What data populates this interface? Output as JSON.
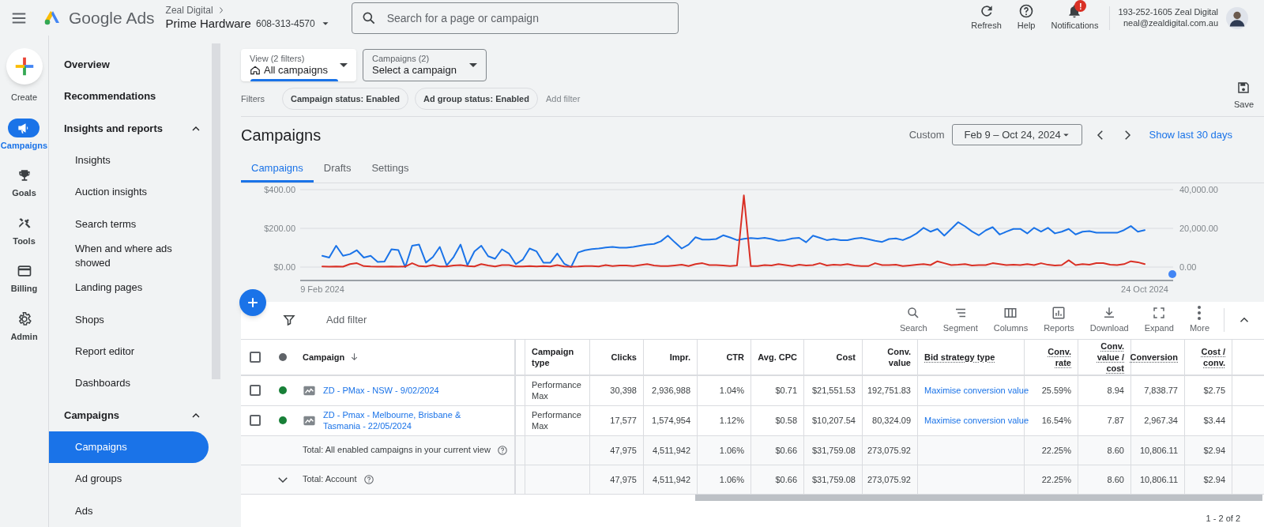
{
  "header": {
    "product": "Google Ads",
    "account": {
      "manager": "Zeal Digital",
      "name": "Prime Hardware",
      "id": "608-313-4570"
    },
    "search": {
      "placeholder": "Search for a page or campaign"
    },
    "actions": [
      {
        "label": "Refresh",
        "kind": "refresh"
      },
      {
        "label": "Help",
        "kind": "help"
      },
      {
        "label": "Notifications",
        "kind": "bell",
        "badge": "!"
      }
    ],
    "user": {
      "line_1": "193-252-1605 Zeal Digital",
      "line_2": "neal@zealdigital.com.au"
    }
  },
  "rail": [
    {
      "label": "Create",
      "kind": "create",
      "selected": false
    },
    {
      "label": "Campaigns",
      "kind": "megaphone",
      "selected": true
    },
    {
      "label": "Goals",
      "kind": "trophy",
      "selected": false
    },
    {
      "label": "Tools",
      "kind": "tools",
      "selected": false
    },
    {
      "label": "Billing",
      "kind": "card",
      "selected": false
    },
    {
      "label": "Admin",
      "kind": "gear",
      "selected": false
    }
  ],
  "nav": [
    {
      "label": "Overview",
      "selected": false
    },
    {
      "label": "Recommendations",
      "selected": false
    },
    {
      "label": "Insights and reports",
      "selected": false,
      "expanded": true,
      "children": [
        {
          "label": "Insights",
          "selected": false
        },
        {
          "label": "Auction insights",
          "selected": false
        },
        {
          "label": "Search terms",
          "selected": false
        },
        {
          "label": "When and where ads showed",
          "selected": false
        },
        {
          "label": "Landing pages",
          "selected": false
        },
        {
          "label": "Shops",
          "selected": false
        },
        {
          "label": "Report editor",
          "selected": false
        },
        {
          "label": "Dashboards",
          "selected": false
        }
      ]
    },
    {
      "label": "Campaigns",
      "selected": false,
      "expanded": true,
      "children": [
        {
          "label": "Campaigns",
          "selected": true
        },
        {
          "label": "Ad groups",
          "selected": false
        },
        {
          "label": "Ads",
          "selected": false
        }
      ]
    }
  ],
  "pickers": [
    {
      "label": "View (2 filters)",
      "value": "All campaigns",
      "kind": "view"
    },
    {
      "label": "Campaigns (2)",
      "value": "Select a campaign",
      "kind": "plain"
    }
  ],
  "filters": {
    "label": "Filters",
    "chips": [
      "Campaign status: Enabled",
      "Ad group status: Enabled"
    ],
    "add": "Add filter"
  },
  "save": "Save",
  "title": "Campaigns",
  "date": {
    "label": "Custom",
    "range": "Feb 9 – Oct 24, 2024",
    "link": "Show last 30 days"
  },
  "tabs": [
    {
      "label": "Campaigns",
      "selected": true
    },
    {
      "label": "Drafts",
      "selected": false
    },
    {
      "label": "Settings",
      "selected": false
    }
  ],
  "chart": {
    "right_ticks": [
      "40,000.00",
      "20,000.00",
      "0.00"
    ],
    "chart_data": {
      "type": "line",
      "ylim": [
        0,
        400
      ],
      "yticks": [
        {
          "value": 0,
          "label": "$0.00"
        },
        {
          "value": 200,
          "label": "$200.00"
        },
        {
          "value": 400,
          "label": "$400.00"
        }
      ],
      "categories": [
        "9 Feb 2024",
        null,
        null,
        null,
        null,
        null,
        null,
        null,
        null,
        null,
        null,
        null,
        null,
        null,
        null,
        null,
        null,
        null,
        null,
        null,
        null,
        null,
        null,
        null,
        null,
        null,
        null,
        null,
        null,
        null,
        null,
        null,
        null,
        null,
        null,
        null,
        null,
        null,
        null,
        null,
        null,
        null,
        null,
        null,
        null,
        null,
        null,
        null,
        null,
        null,
        null,
        null,
        null,
        null,
        null,
        null,
        null,
        null,
        null,
        null,
        null,
        null,
        null,
        null,
        null,
        null,
        null,
        null,
        null,
        null,
        null,
        null,
        null,
        null,
        null,
        null,
        null,
        null,
        null,
        null,
        null,
        null,
        null,
        null,
        null,
        null,
        null,
        null,
        null,
        null,
        null,
        null,
        null,
        null,
        null,
        null,
        null,
        null,
        null,
        null,
        null,
        null,
        null,
        null,
        null,
        null,
        null,
        null,
        null,
        null,
        null,
        null,
        null,
        null,
        null,
        null,
        null,
        null,
        null,
        "24 Oct 2024"
      ],
      "series": [
        {
          "color": "#1a73e8",
          "values": [
            58,
            49,
            110,
            58,
            67,
            87,
            49,
            58,
            27,
            28,
            92,
            88,
            0,
            110,
            116,
            23,
            52,
            104,
            9,
            52,
            116,
            9,
            81,
            110,
            56,
            43,
            92,
            70,
            15,
            38,
            96,
            81,
            23,
            23,
            70,
            17,
            0,
            75,
            87,
            93,
            96,
            101,
            104,
            100,
            100,
            104,
            110,
            116,
            119,
            133,
            162,
            128,
            96,
            116,
            154,
            142,
            142,
            145,
            164,
            153,
            139,
            146,
            150,
            147,
            151,
            145,
            136,
            139,
            148,
            151,
            128,
            162,
            151,
            139,
            145,
            139,
            139,
            147,
            151,
            144,
            136,
            130,
            145,
            148,
            139,
            154,
            174,
            203,
            183,
            197,
            162,
            197,
            232,
            210,
            184,
            164,
            190,
            206,
            168,
            183,
            197,
            197,
            174,
            203,
            183,
            203,
            174,
            183,
            197,
            168,
            183,
            186,
            178,
            178,
            177,
            177,
            191,
            212,
            183,
            191
          ]
        },
        {
          "color": "#d93025",
          "values": [
            3,
            2,
            3,
            2,
            15,
            20,
            5,
            3,
            2,
            2,
            3,
            2,
            3,
            20,
            5,
            3,
            10,
            3,
            3,
            8,
            10,
            5,
            3,
            15,
            8,
            3,
            10,
            10,
            3,
            3,
            5,
            3,
            5,
            3,
            10,
            3,
            2,
            3,
            5,
            5,
            3,
            10,
            5,
            8,
            8,
            5,
            10,
            15,
            8,
            5,
            5,
            8,
            12,
            5,
            15,
            20,
            10,
            10,
            8,
            5,
            8,
            370,
            5,
            5,
            10,
            8,
            15,
            10,
            5,
            12,
            8,
            10,
            20,
            8,
            12,
            10,
            15,
            8,
            5,
            5,
            20,
            10,
            10,
            12,
            5,
            8,
            12,
            15,
            10,
            30,
            20,
            10,
            12,
            15,
            8,
            10,
            10,
            20,
            15,
            10,
            12,
            10,
            15,
            10,
            20,
            12,
            8,
            10,
            35,
            10,
            15,
            12,
            20,
            20,
            12,
            10,
            15,
            30,
            25,
            15
          ]
        }
      ]
    }
  },
  "table": {
    "add_filter": "Add filter",
    "tools": [
      {
        "label": "Search",
        "kind": "search"
      },
      {
        "label": "Segment",
        "kind": "segment"
      },
      {
        "label": "Columns",
        "kind": "columns"
      },
      {
        "label": "Reports",
        "kind": "reports"
      },
      {
        "label": "Download",
        "kind": "download"
      },
      {
        "label": "Expand",
        "kind": "expand"
      },
      {
        "label": "More",
        "kind": "more"
      }
    ],
    "header_checked": false,
    "columns": [
      {
        "label": "Campaign",
        "dotted": false,
        "sorted": true
      },
      {
        "label": "Campaign type",
        "dotted": false,
        "sorted": false
      },
      {
        "label": "Clicks",
        "dotted": false,
        "sorted": false
      },
      {
        "label": "Impr.",
        "dotted": false,
        "sorted": false
      },
      {
        "label": "CTR",
        "dotted": false,
        "sorted": false
      },
      {
        "label": "Avg. CPC",
        "dotted": false,
        "sorted": false
      },
      {
        "label": "Cost",
        "dotted": false,
        "sorted": false
      },
      {
        "label": "Conv. value",
        "dotted": false,
        "sorted": false
      },
      {
        "label": "Bid strategy type",
        "dotted": true,
        "sorted": false
      },
      {
        "label": "Conv. rate",
        "dotted": true,
        "sorted": false
      },
      {
        "label": "Conv. value / cost",
        "dotted": true,
        "sorted": false
      },
      {
        "label": "Conversion",
        "dotted": true,
        "sorted": false
      },
      {
        "label": "Cost / conv.",
        "dotted": true,
        "sorted": false
      }
    ],
    "rows": [
      {
        "kind": "campaign",
        "checked": false,
        "color": "#188038",
        "cells": [
          "ZD - PMax - NSW - 9/02/2024",
          "Performance Max",
          "30,398",
          "2,936,988",
          "1.04%",
          "$0.71",
          "$21,551.53",
          "192,751.83",
          "Maximise conversion value",
          "25.59%",
          "8.94",
          "7,838.77",
          "$2.75"
        ]
      },
      {
        "kind": "campaign",
        "checked": false,
        "color": "#188038",
        "cells": [
          "ZD - Pmax - Melbourne, Brisbane & Tasmania - 22/05/2024",
          "Performance Max",
          "17,577",
          "1,574,954",
          "1.12%",
          "$0.58",
          "$10,207.54",
          "80,324.09",
          "Maximise conversion value",
          "16.54%",
          "7.87",
          "2,967.34",
          "$3.44"
        ]
      },
      {
        "kind": "total",
        "expander": false,
        "cells": [
          "Total: All enabled campaigns in your current view",
          "",
          "47,975",
          "4,511,942",
          "1.06%",
          "$0.66",
          "$31,759.08",
          "273,075.92",
          "",
          "22.25%",
          "8.60",
          "10,806.11",
          "$2.94"
        ]
      },
      {
        "kind": "total",
        "expander": true,
        "cells": [
          "Total: Account",
          "",
          "47,975",
          "4,511,942",
          "1.06%",
          "$0.66",
          "$31,759.08",
          "273,075.92",
          "",
          "22.25%",
          "8.60",
          "10,806.11",
          "$2.94"
        ]
      }
    ],
    "pagination": "1 - 2 of 2"
  }
}
